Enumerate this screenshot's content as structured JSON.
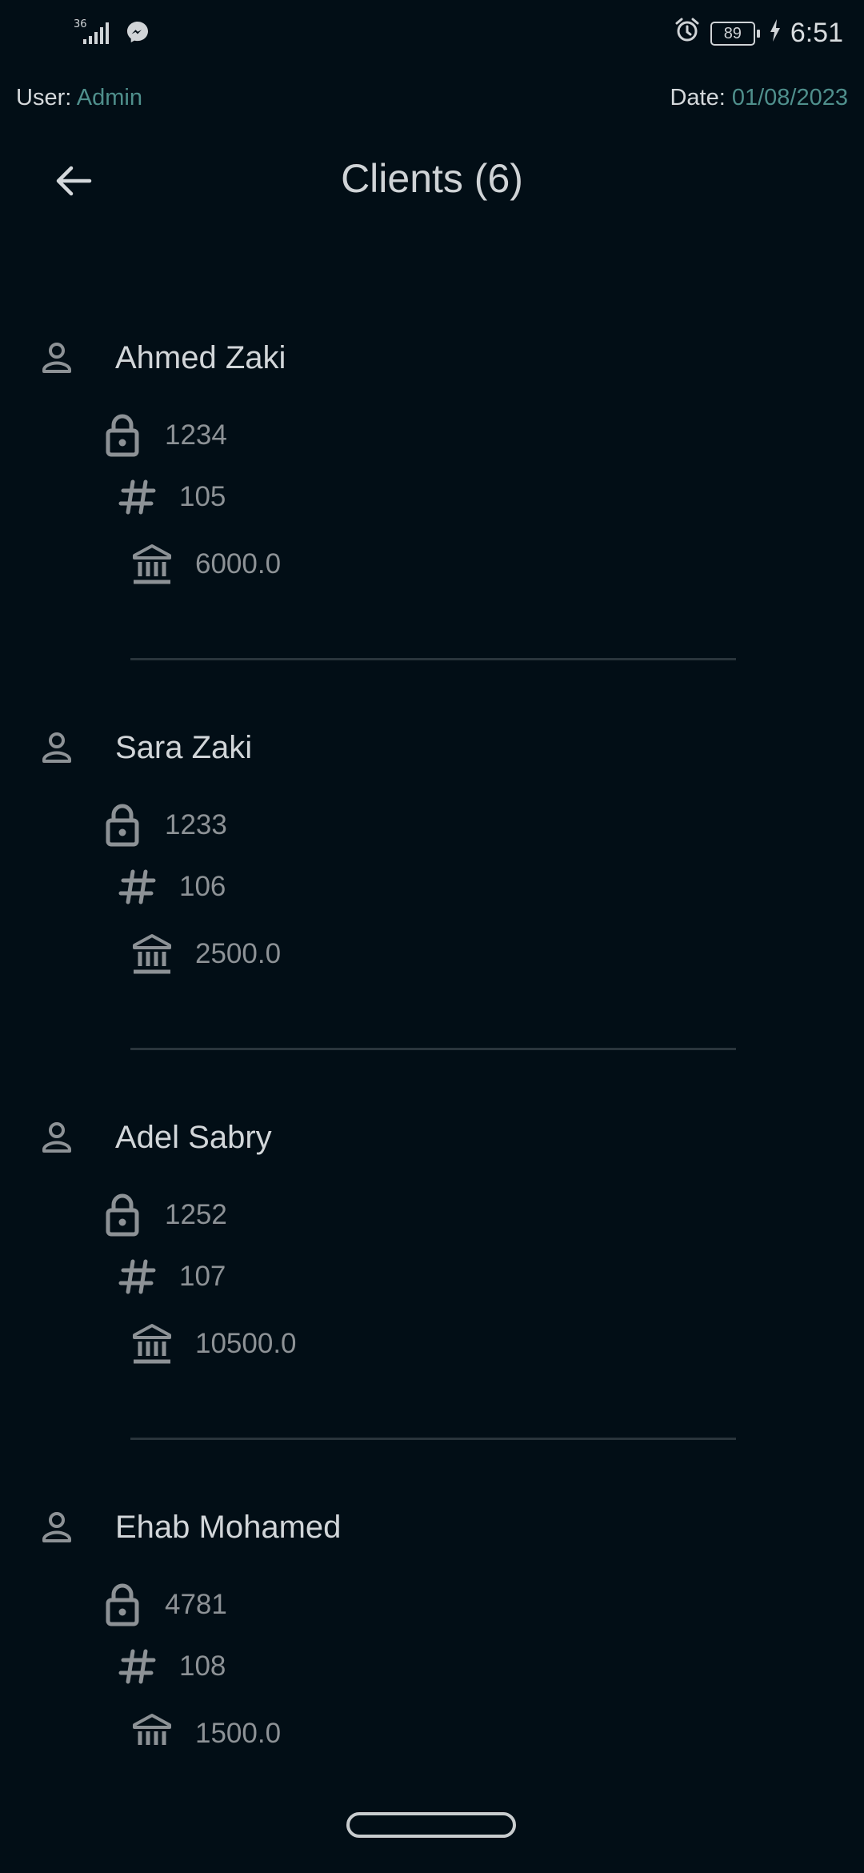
{
  "status_bar": {
    "network": "36",
    "battery": "89",
    "time": "6:51",
    "icons": [
      "signal-icon",
      "messenger-icon",
      "alarm-icon",
      "battery-icon",
      "charging-icon"
    ]
  },
  "meta": {
    "user_label": "User:",
    "user_value": "Admin",
    "date_label": "Date:",
    "date_value": "01/08/2023"
  },
  "header": {
    "title": "Clients (6)"
  },
  "clients": [
    {
      "name": "Ahmed Zaki",
      "pin": "1234",
      "number": "105",
      "balance": "6000.0"
    },
    {
      "name": "Sara Zaki",
      "pin": "1233",
      "number": "106",
      "balance": "2500.0"
    },
    {
      "name": "Adel Sabry",
      "pin": "1252",
      "number": "107",
      "balance": "10500.0"
    },
    {
      "name": "Ehab Mohamed",
      "pin": "4781",
      "number": "108",
      "balance": "1500.0"
    }
  ],
  "colors": {
    "background": "#020e16",
    "accent": "#4f8f8c",
    "text": "#cfd3d6",
    "muted": "#8d9296"
  }
}
